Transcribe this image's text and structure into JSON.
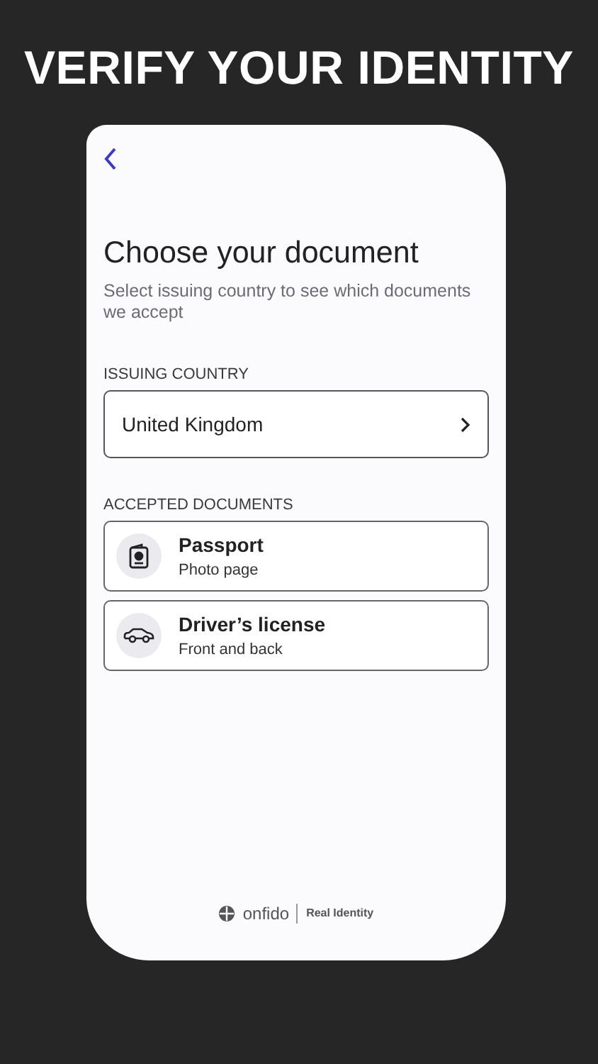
{
  "headline": "VERIFY YOUR IDENTITY",
  "screen": {
    "title": "Choose your document",
    "subtitle": "Select issuing country to see which documents we accept",
    "country_label": "ISSUING COUNTRY",
    "country": "United Kingdom",
    "documents_label": "ACCEPTED DOCUMENTS",
    "documents": [
      {
        "kind": "passport",
        "name": "Passport",
        "detail": "Photo page"
      },
      {
        "kind": "car",
        "name": "Driver’s license",
        "detail": "Front and back"
      }
    ],
    "footer": {
      "brand": "onfido",
      "tagline": "Real Identity"
    }
  }
}
